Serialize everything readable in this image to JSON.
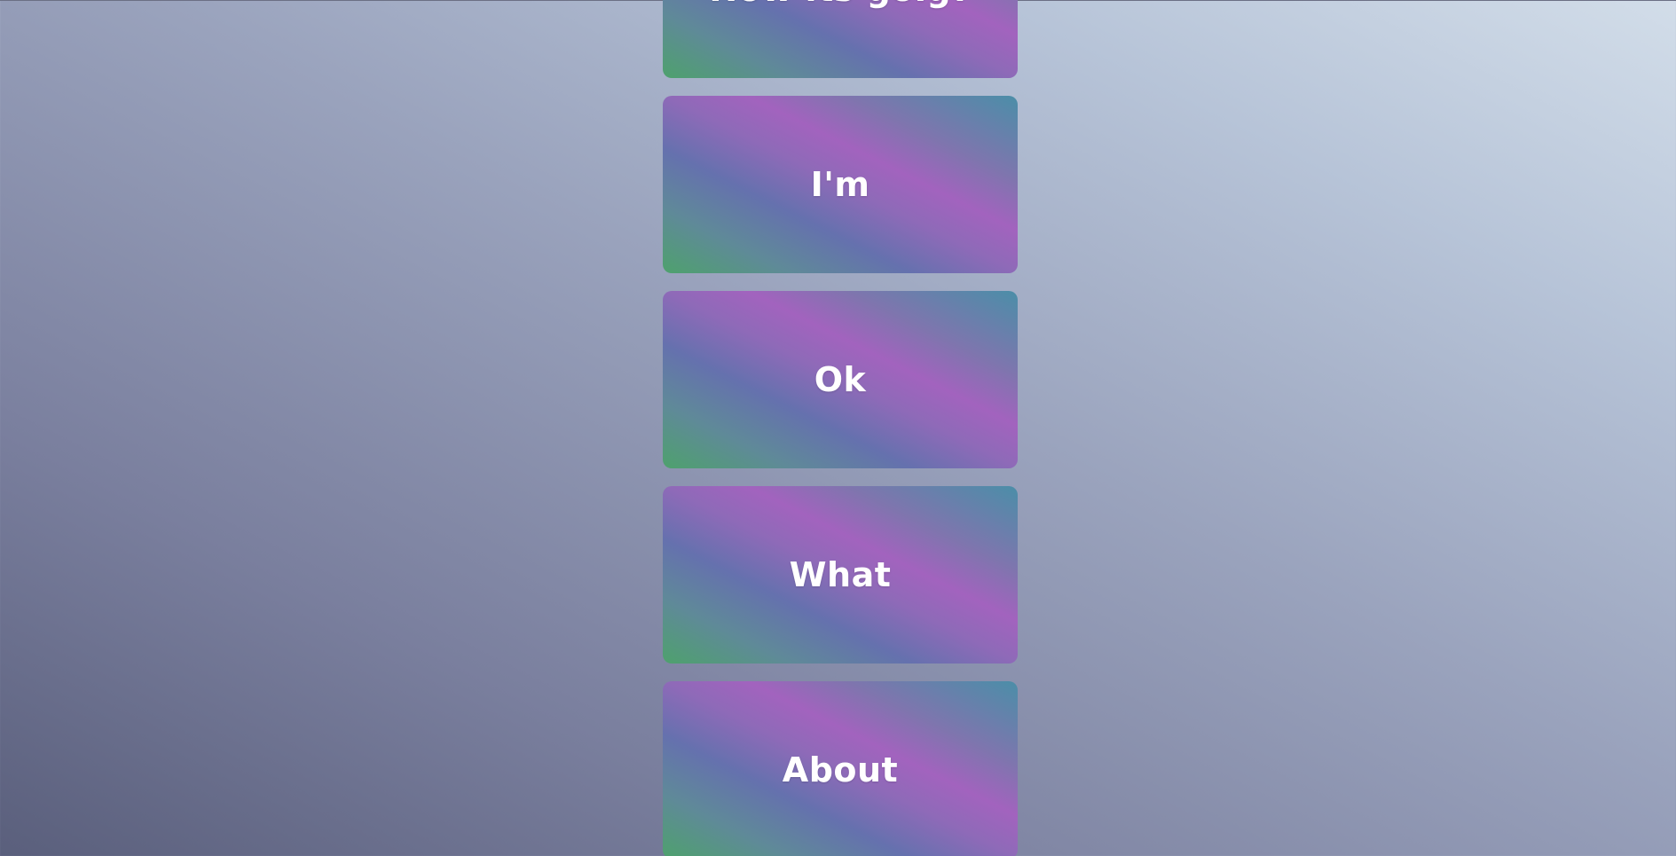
{
  "cards": [
    {
      "label": "How its goig?"
    },
    {
      "label": "I'm"
    },
    {
      "label": "Ok"
    },
    {
      "label": "What"
    },
    {
      "label": "About"
    }
  ]
}
